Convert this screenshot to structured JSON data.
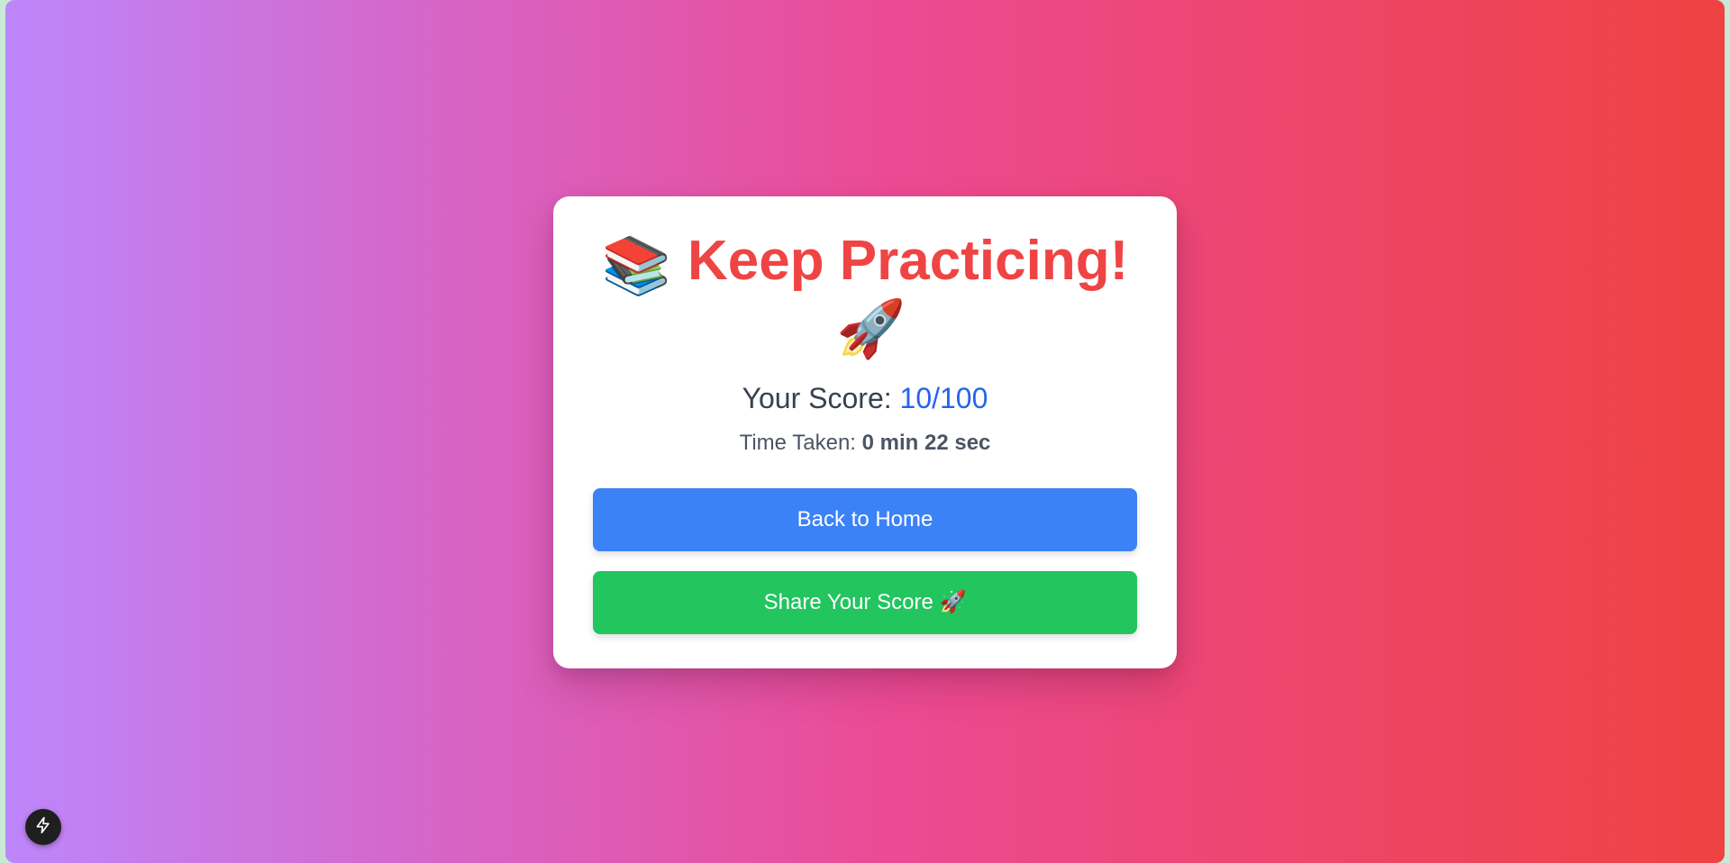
{
  "result": {
    "headline": {
      "leading_emoji": "📚",
      "text": "Keep Practicing!",
      "trailing_emoji": "🚀",
      "color": "#ef4444"
    },
    "score": {
      "label": "Your Score: ",
      "value": "10/100",
      "value_color": "#2563eb"
    },
    "time": {
      "label": "Time Taken: ",
      "value": "0 min 22 sec"
    }
  },
  "actions": {
    "back_home_label": "Back to Home",
    "back_home_color": "#3b82f6",
    "share_label": "Share Your Score 🚀",
    "share_color": "#22c55e"
  },
  "corner_badge": {
    "icon": "lightning-bolt-icon"
  },
  "background": {
    "gradient_colors": [
      "#bd86fb",
      "#ec4a93",
      "#ef4242"
    ]
  }
}
